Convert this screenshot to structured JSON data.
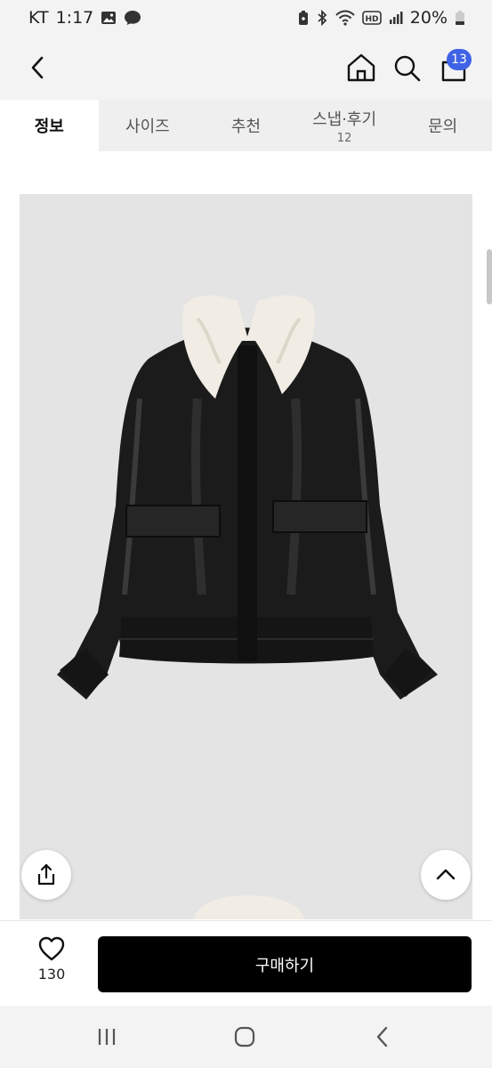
{
  "status_bar": {
    "carrier": "KT",
    "time": "1:17",
    "battery": "20%",
    "icons": [
      "image-icon",
      "chat-bubble-icon",
      "battery-saver-icon",
      "bluetooth-icon",
      "wifi-icon",
      "hd-icon",
      "signal-icon",
      "battery-icon"
    ]
  },
  "header": {
    "icons": [
      "back-icon",
      "home-icon",
      "search-icon",
      "shopping-bag-icon"
    ],
    "cart_badge": "13"
  },
  "tabs": [
    {
      "label": "정보",
      "active": true
    },
    {
      "label": "사이즈",
      "active": false
    },
    {
      "label": "추천",
      "active": false
    },
    {
      "label": "스냅·후기",
      "count": "12",
      "active": false
    },
    {
      "label": "문의",
      "active": false
    }
  ],
  "product": {
    "image": "black-leather-bomber-jacket-with-shearling-collar",
    "share_icon": "share-icon",
    "top_icon": "chevron-up-icon"
  },
  "bottom_bar": {
    "like_icon": "heart-icon",
    "like_count": "130",
    "buy_label": "구매하기"
  },
  "nav_bar": {
    "icons": [
      "recent-apps-icon",
      "home-circle-icon",
      "back-icon"
    ]
  },
  "colors": {
    "accent": "#3f63e6",
    "buy_button": "#000000",
    "header_bg": "#f3f3f3",
    "tab_bg": "#efefef",
    "image_bg": "#e4e4e4"
  }
}
